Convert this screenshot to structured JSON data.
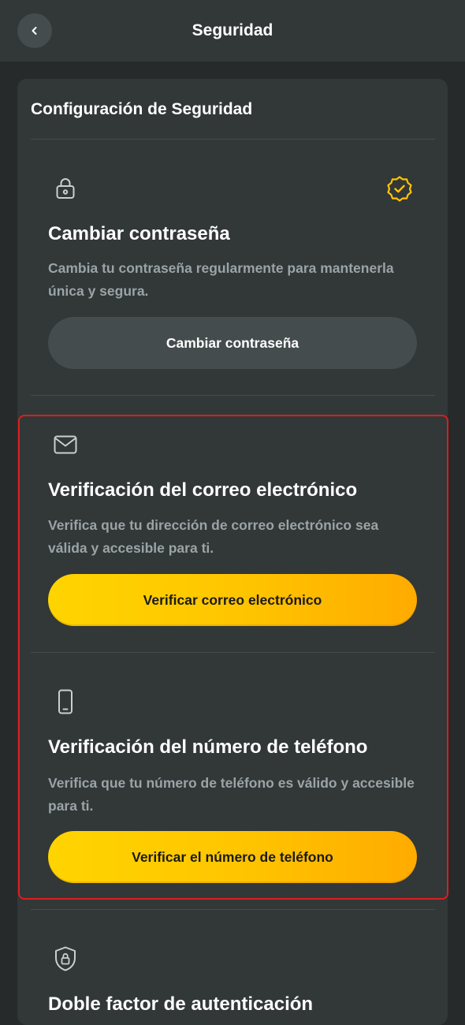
{
  "header": {
    "title": "Seguridad",
    "back_icon": "chevron-left-icon"
  },
  "panel": {
    "title": "Configuración de Seguridad"
  },
  "sections": [
    {
      "icon": "lock-icon",
      "status_icon": "verified-badge-icon",
      "title": "Cambiar contraseña",
      "description": "Cambia tu contraseña regularmente para mantenerla única y segura.",
      "button_label": "Cambiar contraseña"
    },
    {
      "icon": "mail-icon",
      "title": "Verificación del correo electrónico",
      "description": "Verifica que tu dirección de correo electrónico sea válida y accesible para ti.",
      "button_label": "Verificar correo electrónico"
    },
    {
      "icon": "phone-icon",
      "title": "Verificación del número de teléfono",
      "description": "Verifica que tu número de teléfono es válido y accesible para ti.",
      "button_label": "Verificar el número de teléfono"
    },
    {
      "icon": "shield-lock-icon",
      "title": "Doble factor de autenticación"
    }
  ],
  "colors": {
    "background": "#272a2b",
    "surface": "#323738",
    "accent": "#ffc600",
    "highlight_border": "#e01c1c",
    "muted_text": "#9aa4a7"
  }
}
